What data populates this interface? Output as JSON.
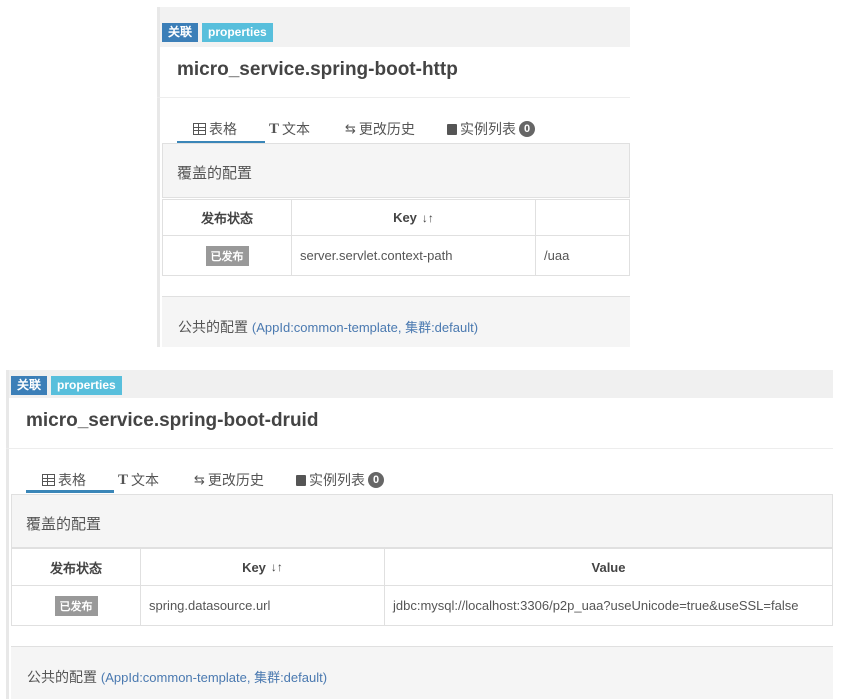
{
  "common": {
    "badge_relation": "关联",
    "badge_format": "properties",
    "tabs": [
      {
        "label": "表格",
        "icon": "table-icon"
      },
      {
        "label": "文本",
        "icon": "text-icon"
      },
      {
        "label": "更改历史",
        "icon": "history-icon"
      },
      {
        "label": "实例列表",
        "icon": "list-icon",
        "count": "0"
      }
    ],
    "override_title": "覆盖的配置",
    "col_status": "发布状态",
    "col_key": "Key",
    "col_value": "Value",
    "published": "已发布",
    "public_title": "公共的配置",
    "public_info": "(AppId:common-template, 集群:default)"
  },
  "panels": [
    {
      "namespace": "micro_service.spring-boot-http",
      "row": {
        "key": "server.servlet.context-path",
        "value": "/uaa"
      }
    },
    {
      "namespace": "micro_service.spring-boot-druid",
      "row": {
        "key": "spring.datasource.url",
        "value": "jdbc:mysql://localhost:3306/p2p_uaa?useUnicode=true&useSSL=false"
      }
    }
  ],
  "colors": {
    "accent": "#3a86b8",
    "badge_relation": "#3c7fb8",
    "badge_format": "#58bfdc",
    "link": "#4a79b0"
  }
}
